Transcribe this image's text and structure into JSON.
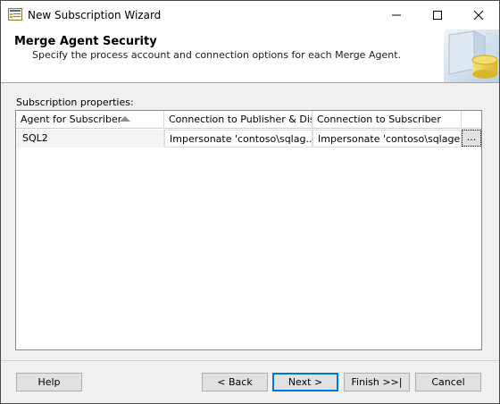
{
  "window": {
    "title": "New Subscription Wizard",
    "controls": {
      "minimize": "—",
      "maximize": "☐",
      "close": "✕"
    }
  },
  "banner": {
    "title": "Merge Agent Security",
    "subtitle": "Specify the process account and connection options for each Merge Agent.",
    "art_icon": "database-server-icon"
  },
  "properties": {
    "label": "Subscription properties:",
    "columns": [
      "Agent for Subscriber",
      "Connection to Publisher & Dis...",
      "Connection to Subscriber",
      ""
    ],
    "sort_column": "Agent for Subscriber",
    "rows": [
      {
        "agent": "SQL2",
        "publisher_connection": "Impersonate 'contoso\\sqlag...",
        "subscriber_connection": "Impersonate 'contoso\\sqlagent'",
        "action": "..."
      }
    ]
  },
  "footer": {
    "help": "Help",
    "back": "< Back",
    "next": "Next >",
    "finish": "Finish >>|",
    "cancel": "Cancel"
  },
  "colors": {
    "default_button_border": "#0078d7",
    "dialog_bg": "#f0f0f0"
  }
}
